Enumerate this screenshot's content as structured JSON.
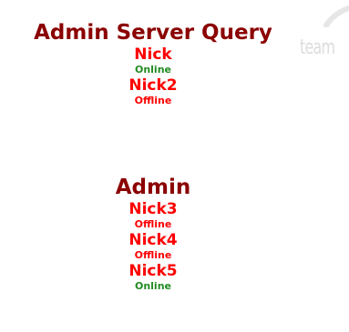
{
  "watermark": {
    "text": "team",
    "color": "#dcdcdc"
  },
  "groups": [
    {
      "title": "Admin Server Query",
      "players": [
        {
          "name": "Nick",
          "status": "Online"
        },
        {
          "name": "Nick2",
          "status": "Offline"
        }
      ]
    },
    {
      "title": "Admin",
      "players": [
        {
          "name": "Nick3",
          "status": "Offline"
        },
        {
          "name": "Nick4",
          "status": "Offline"
        },
        {
          "name": "Nick5",
          "status": "Online"
        }
      ]
    }
  ],
  "colors": {
    "group_title": "#8b0000",
    "player_name": "#ff0000",
    "online": "#228b22",
    "offline": "#ff0000"
  }
}
